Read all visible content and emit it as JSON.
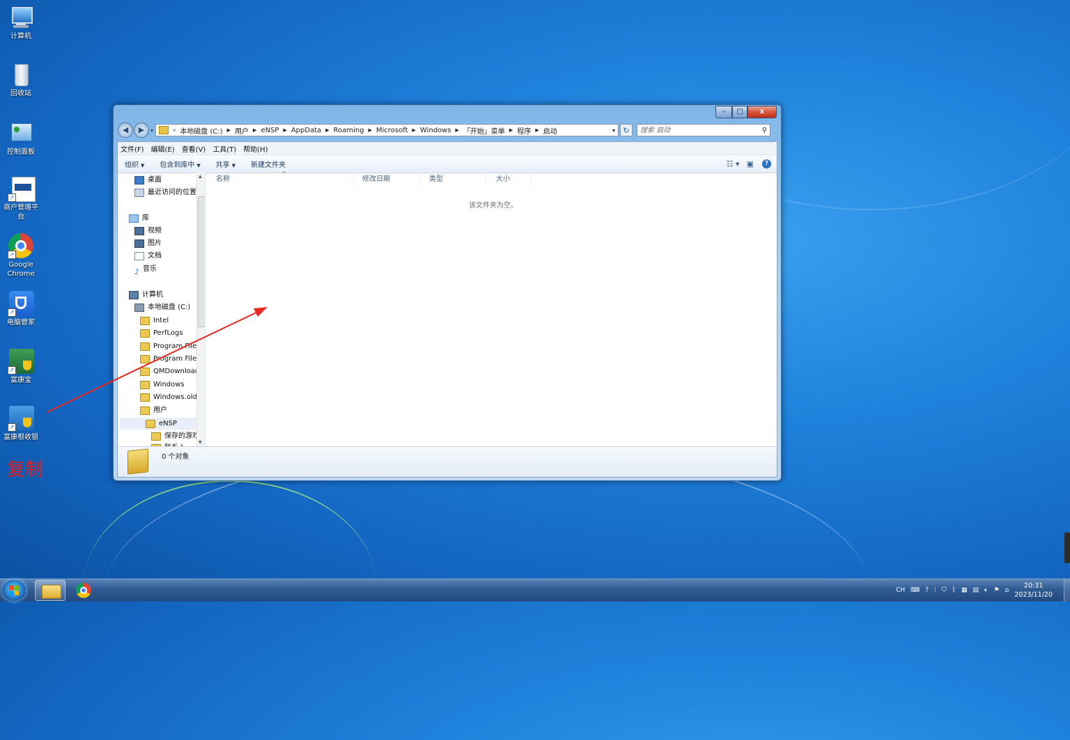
{
  "desktop": {
    "icons": [
      {
        "label": "计算机",
        "icon": "computer-icon"
      },
      {
        "label": "回收站",
        "icon": "recycle-bin-icon"
      },
      {
        "label": "控制面板",
        "icon": "control-panel-icon"
      },
      {
        "label": "商户管理平台",
        "icon": "merchant-platform-icon"
      },
      {
        "label": "Google Chrome",
        "icon": "chrome-icon"
      },
      {
        "label": "电脑管家",
        "icon": "pc-manager-icon"
      },
      {
        "label": "富康宝",
        "icon": "fukangbao-icon"
      },
      {
        "label": "富康根收银",
        "icon": "cashier-icon"
      }
    ],
    "overlay_text": "复制",
    "overlay_color": "#e02020"
  },
  "window": {
    "controls": {
      "minimize": "–",
      "maximize": "□",
      "close": "x"
    },
    "nav": {
      "back": "◀",
      "forward": "▶",
      "history_dropdown": "▾"
    },
    "address": {
      "chevron": "«",
      "segments": [
        "本地磁盘 (C:)",
        "用户",
        "eNSP",
        "AppData",
        "Roaming",
        "Microsoft",
        "Windows",
        "「开始」菜单",
        "程序",
        "启动"
      ],
      "dropdown": "▾"
    },
    "refresh": "↻",
    "search": {
      "placeholder": "搜索 启动",
      "icon": "search-icon"
    },
    "menus": [
      "文件(F)",
      "编辑(E)",
      "查看(V)",
      "工具(T)",
      "帮助(H)"
    ],
    "commands": [
      "组织",
      "包含到库中",
      "共享",
      "新建文件夹"
    ],
    "command_arrows": [
      true,
      true,
      true,
      false
    ],
    "nav_tree": [
      {
        "label": "桌面",
        "icon": "desktop-icon",
        "indent": 1
      },
      {
        "label": "最近访问的位置",
        "icon": "recent-icon",
        "indent": 1
      },
      {
        "label": "库",
        "icon": "library-icon",
        "indent": 0
      },
      {
        "label": "视频",
        "icon": "video-icon",
        "indent": 1
      },
      {
        "label": "图片",
        "icon": "picture-icon",
        "indent": 1
      },
      {
        "label": "文档",
        "icon": "document-icon",
        "indent": 1
      },
      {
        "label": "音乐",
        "icon": "music-icon",
        "indent": 1
      },
      {
        "label": "计算机",
        "icon": "computer-icon",
        "indent": 0
      },
      {
        "label": "本地磁盘 (C:)",
        "icon": "drive-icon",
        "indent": 1
      },
      {
        "label": "Intel",
        "icon": "folder-icon",
        "indent": 2
      },
      {
        "label": "PerfLogs",
        "icon": "folder-icon",
        "indent": 2
      },
      {
        "label": "Program Files",
        "icon": "folder-icon",
        "indent": 2
      },
      {
        "label": "Program Files",
        "icon": "folder-icon",
        "indent": 2
      },
      {
        "label": "QMDownload",
        "icon": "folder-icon",
        "indent": 2
      },
      {
        "label": "Windows",
        "icon": "folder-icon",
        "indent": 2
      },
      {
        "label": "Windows.old",
        "icon": "folder-icon",
        "indent": 2
      },
      {
        "label": "用户",
        "icon": "folder-icon",
        "indent": 2
      },
      {
        "label": "eNSP",
        "icon": "user-folder-icon",
        "indent": 3
      },
      {
        "label": "保存的游戏",
        "icon": "folder-icon",
        "indent": 4
      },
      {
        "label": "联系人",
        "icon": "folder-icon",
        "indent": 4
      }
    ],
    "columns": [
      "名称",
      "修改日期",
      "类型",
      "大小"
    ],
    "sort_indicator": "^",
    "empty_message": "该文件夹为空。",
    "status": {
      "object_count": "0 个对象"
    }
  },
  "taskbar": {
    "items": [
      {
        "name": "start-button"
      },
      {
        "name": "explorer",
        "icon": "folder-icon",
        "active": true
      },
      {
        "name": "chrome",
        "icon": "chrome-icon",
        "active": false
      }
    ],
    "tray": {
      "lang": "CH",
      "time": "20:31",
      "date": "2023/11/20"
    }
  },
  "colors": {
    "arrow": "#e8281e",
    "window_frame": "#7fb6e8",
    "desktop": "#1f82dc"
  }
}
